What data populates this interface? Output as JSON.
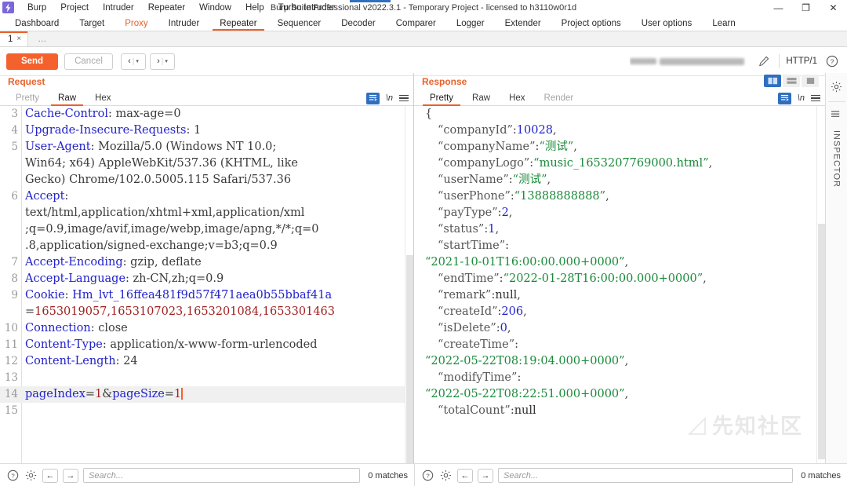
{
  "window": {
    "title": "Burp Suite Professional v2022.3.1 - Temporary Project - licensed to h3110w0r1d",
    "minimize": "—",
    "maximize": "❐",
    "close": "✕"
  },
  "menu": {
    "items": [
      "Burp",
      "Project",
      "Intruder",
      "Repeater",
      "Window",
      "Help",
      "Turbo Intruder"
    ]
  },
  "main_tabs": [
    {
      "label": "Dashboard",
      "state": "normal"
    },
    {
      "label": "Target",
      "state": "normal"
    },
    {
      "label": "Proxy",
      "state": "highlight"
    },
    {
      "label": "Intruder",
      "state": "normal"
    },
    {
      "label": "Repeater",
      "state": "active"
    },
    {
      "label": "Sequencer",
      "state": "normal"
    },
    {
      "label": "Decoder",
      "state": "normal"
    },
    {
      "label": "Comparer",
      "state": "normal"
    },
    {
      "label": "Logger",
      "state": "normal"
    },
    {
      "label": "Extender",
      "state": "normal"
    },
    {
      "label": "Project options",
      "state": "normal"
    },
    {
      "label": "User options",
      "state": "normal"
    },
    {
      "label": "Learn",
      "state": "normal"
    }
  ],
  "repeater_tabs": {
    "tab_label": "1",
    "close_glyph": "×",
    "add_label": "…"
  },
  "toolbar": {
    "send_label": "Send",
    "cancel_label": "Cancel",
    "prev_glyph": "‹",
    "next_glyph": "›",
    "caret_glyph": "▾",
    "divider": "|",
    "http_version": "HTTP/1",
    "help_glyph": "?"
  },
  "request_panel": {
    "title": "Request",
    "tabs": [
      {
        "label": "Pretty",
        "state": "muted"
      },
      {
        "label": "Raw",
        "state": "active"
      },
      {
        "label": "Hex",
        "state": "normal"
      }
    ],
    "newline_glyph": "\\n",
    "lines": [
      {
        "num": "3",
        "segments": [
          {
            "t": "Cache-Control",
            "c": "hdr"
          },
          {
            "t": ": max-age=0",
            "c": "plain"
          }
        ]
      },
      {
        "num": "4",
        "segments": [
          {
            "t": "Upgrade-Insecure-Requests",
            "c": "hdr"
          },
          {
            "t": ": 1",
            "c": "plain"
          }
        ]
      },
      {
        "num": "5",
        "segments": [
          {
            "t": "User-Agent",
            "c": "hdr"
          },
          {
            "t": ": Mozilla/5.0 (Windows NT 10.0;",
            "c": "plain"
          }
        ]
      },
      {
        "num": "",
        "segments": [
          {
            "t": "Win64; x64) AppleWebKit/537.36 (KHTML, like",
            "c": "plain"
          }
        ]
      },
      {
        "num": "",
        "segments": [
          {
            "t": "Gecko) Chrome/102.0.5005.115 Safari/537.36",
            "c": "plain"
          }
        ]
      },
      {
        "num": "6",
        "segments": [
          {
            "t": "Accept",
            "c": "hdr"
          },
          {
            "t": ":",
            "c": "plain"
          }
        ]
      },
      {
        "num": "",
        "segments": [
          {
            "t": "text/html,application/xhtml+xml,application/xml",
            "c": "plain"
          }
        ]
      },
      {
        "num": "",
        "segments": [
          {
            "t": ";q=0.9,image/avif,image/webp,image/apng,*/*;q=0",
            "c": "plain"
          }
        ]
      },
      {
        "num": "",
        "segments": [
          {
            "t": ".8,application/signed-exchange;v=b3;q=0.9",
            "c": "plain"
          }
        ]
      },
      {
        "num": "7",
        "segments": [
          {
            "t": "Accept-Encoding",
            "c": "hdr"
          },
          {
            "t": ": gzip, deflate",
            "c": "plain"
          }
        ]
      },
      {
        "num": "8",
        "segments": [
          {
            "t": "Accept-Language",
            "c": "hdr"
          },
          {
            "t": ": zh-CN,zh;q=0.9",
            "c": "plain"
          }
        ]
      },
      {
        "num": "9",
        "segments": [
          {
            "t": "Cookie",
            "c": "hdr"
          },
          {
            "t": ": ",
            "c": "plain"
          },
          {
            "t": "Hm_lvt_16ffea481f9d57f471aea0b55bbaf41a",
            "c": "hdr"
          }
        ]
      },
      {
        "num": "",
        "segments": [
          {
            "t": "=",
            "c": "plain"
          },
          {
            "t": "1653019057,1653107023,1653201084,1653301463",
            "c": "red"
          }
        ]
      },
      {
        "num": "10",
        "segments": [
          {
            "t": "Connection",
            "c": "hdr"
          },
          {
            "t": ": close",
            "c": "plain"
          }
        ]
      },
      {
        "num": "11",
        "segments": [
          {
            "t": "Content-Type",
            "c": "hdr"
          },
          {
            "t": ": application/x-www-form-urlencoded",
            "c": "plain"
          }
        ]
      },
      {
        "num": "12",
        "segments": [
          {
            "t": "Content-Length",
            "c": "hdr"
          },
          {
            "t": ": 24",
            "c": "plain"
          }
        ]
      },
      {
        "num": "13",
        "segments": []
      },
      {
        "num": "14",
        "highlight": true,
        "caret": true,
        "segments": [
          {
            "t": "pageIndex",
            "c": "hdr"
          },
          {
            "t": "=",
            "c": "plain"
          },
          {
            "t": "1",
            "c": "red"
          },
          {
            "t": "&",
            "c": "plain"
          },
          {
            "t": "pageSize",
            "c": "hdr"
          },
          {
            "t": "=",
            "c": "plain"
          },
          {
            "t": "1",
            "c": "red"
          }
        ]
      },
      {
        "num": "15",
        "segments": []
      }
    ],
    "status": {
      "help_glyph": "?",
      "gear_glyph": "⚙",
      "prev_glyph": "←",
      "next_glyph": "→",
      "search_placeholder": "Search...",
      "matches": "0 matches"
    }
  },
  "response_panel": {
    "title": "Response",
    "tabs": [
      {
        "label": "Pretty",
        "state": "active"
      },
      {
        "label": "Raw",
        "state": "normal"
      },
      {
        "label": "Hex",
        "state": "normal"
      },
      {
        "label": "Render",
        "state": "muted"
      }
    ],
    "newline_glyph": "\\n",
    "layout_buttons": [
      "split-vertical",
      "split-horizontal",
      "single-pane"
    ],
    "active_layout": "split-vertical",
    "lines": [
      {
        "indent": 0,
        "segments": [
          {
            "t": "{",
            "c": "punc"
          }
        ]
      },
      {
        "indent": 1,
        "segments": [
          {
            "t": "“companyId”",
            "c": "key"
          },
          {
            "t": ":",
            "c": "punc"
          },
          {
            "t": "10028",
            "c": "num"
          },
          {
            "t": ",",
            "c": "punc"
          }
        ]
      },
      {
        "indent": 1,
        "segments": [
          {
            "t": "“companyName”",
            "c": "key"
          },
          {
            "t": ":",
            "c": "punc"
          },
          {
            "t": "“测试”",
            "c": "str"
          },
          {
            "t": ",",
            "c": "punc"
          }
        ]
      },
      {
        "indent": 1,
        "segments": [
          {
            "t": "“companyLogo”",
            "c": "key"
          },
          {
            "t": ":",
            "c": "punc"
          },
          {
            "t": "“music_1653207769000.html”",
            "c": "str"
          },
          {
            "t": ",",
            "c": "punc"
          }
        ]
      },
      {
        "indent": 1,
        "segments": [
          {
            "t": "“userName”",
            "c": "key"
          },
          {
            "t": ":",
            "c": "punc"
          },
          {
            "t": "“测试”",
            "c": "str"
          },
          {
            "t": ",",
            "c": "punc"
          }
        ]
      },
      {
        "indent": 1,
        "segments": [
          {
            "t": "“userPhone”",
            "c": "key"
          },
          {
            "t": ":",
            "c": "punc"
          },
          {
            "t": "“13888888888”",
            "c": "str"
          },
          {
            "t": ",",
            "c": "punc"
          }
        ]
      },
      {
        "indent": 1,
        "segments": [
          {
            "t": "“payType”",
            "c": "key"
          },
          {
            "t": ":",
            "c": "punc"
          },
          {
            "t": "2",
            "c": "num"
          },
          {
            "t": ",",
            "c": "punc"
          }
        ]
      },
      {
        "indent": 1,
        "segments": [
          {
            "t": "“status”",
            "c": "key"
          },
          {
            "t": ":",
            "c": "punc"
          },
          {
            "t": "1",
            "c": "num"
          },
          {
            "t": ",",
            "c": "punc"
          }
        ]
      },
      {
        "indent": 1,
        "segments": [
          {
            "t": "“startTime”",
            "c": "key"
          },
          {
            "t": ":",
            "c": "punc"
          }
        ]
      },
      {
        "indent": 0,
        "segments": [
          {
            "t": "“2021-10-01T16:00:00.000+0000”",
            "c": "str"
          },
          {
            "t": ",",
            "c": "punc"
          }
        ]
      },
      {
        "indent": 1,
        "segments": [
          {
            "t": "“endTime”",
            "c": "key"
          },
          {
            "t": ":",
            "c": "punc"
          },
          {
            "t": "“2022-01-28T16:00:00.000+0000”",
            "c": "str"
          },
          {
            "t": ",",
            "c": "punc"
          }
        ]
      },
      {
        "indent": 1,
        "segments": [
          {
            "t": "“remark”",
            "c": "key"
          },
          {
            "t": ":",
            "c": "punc"
          },
          {
            "t": "null",
            "c": "null"
          },
          {
            "t": ",",
            "c": "punc"
          }
        ]
      },
      {
        "indent": 1,
        "segments": [
          {
            "t": "“createId”",
            "c": "key"
          },
          {
            "t": ":",
            "c": "punc"
          },
          {
            "t": "206",
            "c": "num"
          },
          {
            "t": ",",
            "c": "punc"
          }
        ]
      },
      {
        "indent": 1,
        "segments": [
          {
            "t": "“isDelete”",
            "c": "key"
          },
          {
            "t": ":",
            "c": "punc"
          },
          {
            "t": "0",
            "c": "num"
          },
          {
            "t": ",",
            "c": "punc"
          }
        ]
      },
      {
        "indent": 1,
        "segments": [
          {
            "t": "“createTime”",
            "c": "key"
          },
          {
            "t": ":",
            "c": "punc"
          }
        ]
      },
      {
        "indent": 0,
        "segments": [
          {
            "t": "“2022-05-22T08:19:04.000+0000”",
            "c": "str"
          },
          {
            "t": ",",
            "c": "punc"
          }
        ]
      },
      {
        "indent": 1,
        "segments": [
          {
            "t": "“modifyTime”",
            "c": "key"
          },
          {
            "t": ":",
            "c": "punc"
          }
        ]
      },
      {
        "indent": 0,
        "segments": [
          {
            "t": "“2022-05-22T08:22:51.000+0000”",
            "c": "str"
          },
          {
            "t": ",",
            "c": "punc"
          }
        ]
      },
      {
        "indent": 1,
        "segments": [
          {
            "t": "“totalCount”",
            "c": "key"
          },
          {
            "t": ":",
            "c": "punc"
          },
          {
            "t": "null",
            "c": "null"
          }
        ]
      }
    ],
    "status": {
      "help_glyph": "?",
      "gear_glyph": "⚙",
      "prev_glyph": "←",
      "next_glyph": "→",
      "search_placeholder": "Search...",
      "matches": "0 matches"
    }
  },
  "sidebar": {
    "gear_glyph": "⚙",
    "inspector_label": "INSPECTOR"
  },
  "watermark": {
    "text": "先知社区"
  },
  "colors": {
    "accent_orange": "#e8622c",
    "send_orange": "#f5612c",
    "active_blue": "#2f6fc0",
    "header_blue": "#2222cc",
    "string_green": "#1a8a3a",
    "cookie_red": "#a02020"
  }
}
